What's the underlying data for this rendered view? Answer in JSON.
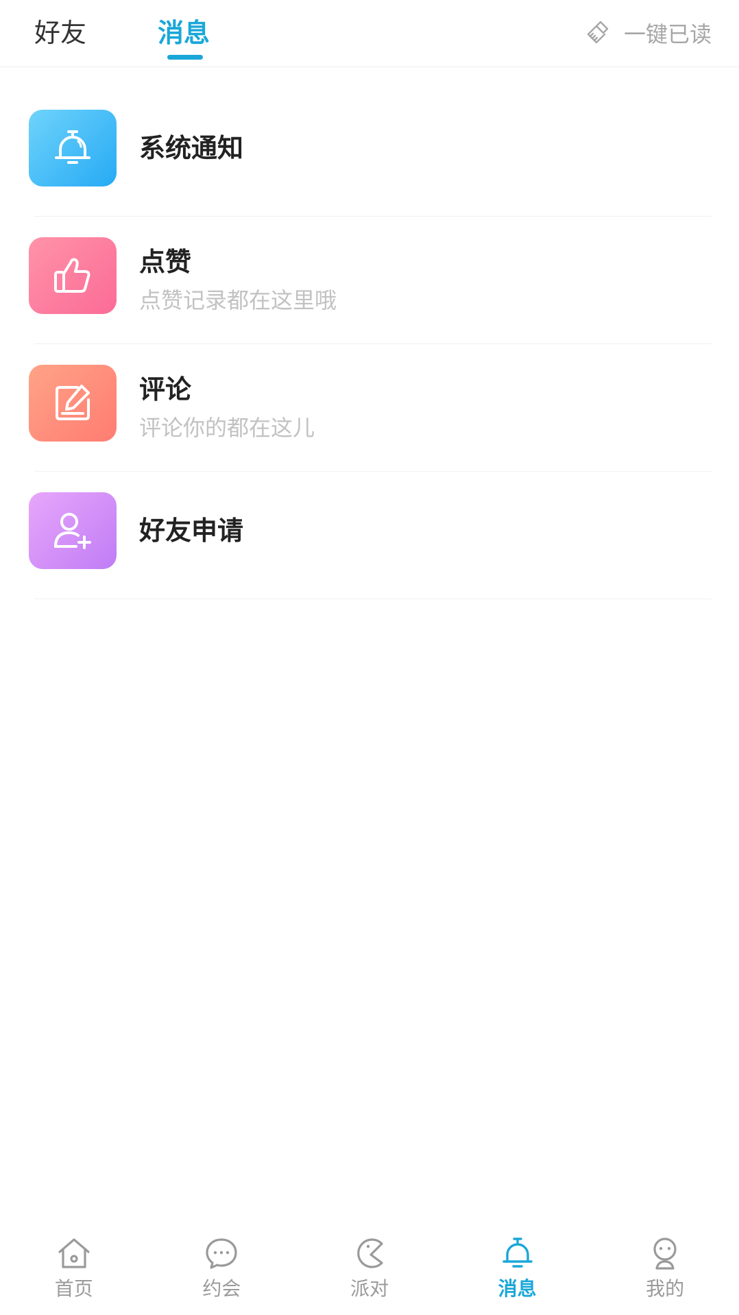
{
  "header": {
    "tabs": [
      {
        "label": "好友",
        "active": false
      },
      {
        "label": "消息",
        "active": true
      }
    ],
    "mark_all_read": "一键已读"
  },
  "messages": [
    {
      "title": "系统通知",
      "subtitle": "",
      "icon": "bell-icon",
      "color": "#26aaf4"
    },
    {
      "title": "点赞",
      "subtitle": "点赞记录都在这里哦",
      "icon": "thumbs-up-icon",
      "color": "#fb6b97"
    },
    {
      "title": "评论",
      "subtitle": "评论你的都在这儿",
      "icon": "edit-icon",
      "color": "#ff7c72"
    },
    {
      "title": "好友申请",
      "subtitle": "",
      "icon": "add-user-icon",
      "color": "#c07cf5"
    }
  ],
  "bottom_nav": [
    {
      "label": "首页",
      "icon": "home-icon",
      "active": false
    },
    {
      "label": "约会",
      "icon": "chat-bubble-icon",
      "active": false
    },
    {
      "label": "派对",
      "icon": "pacman-icon",
      "active": false
    },
    {
      "label": "消息",
      "icon": "bell-icon",
      "active": true
    },
    {
      "label": "我的",
      "icon": "profile-face-icon",
      "active": false
    }
  ],
  "colors": {
    "accent": "#1aa7d8",
    "inactive": "#9a9a9a"
  }
}
